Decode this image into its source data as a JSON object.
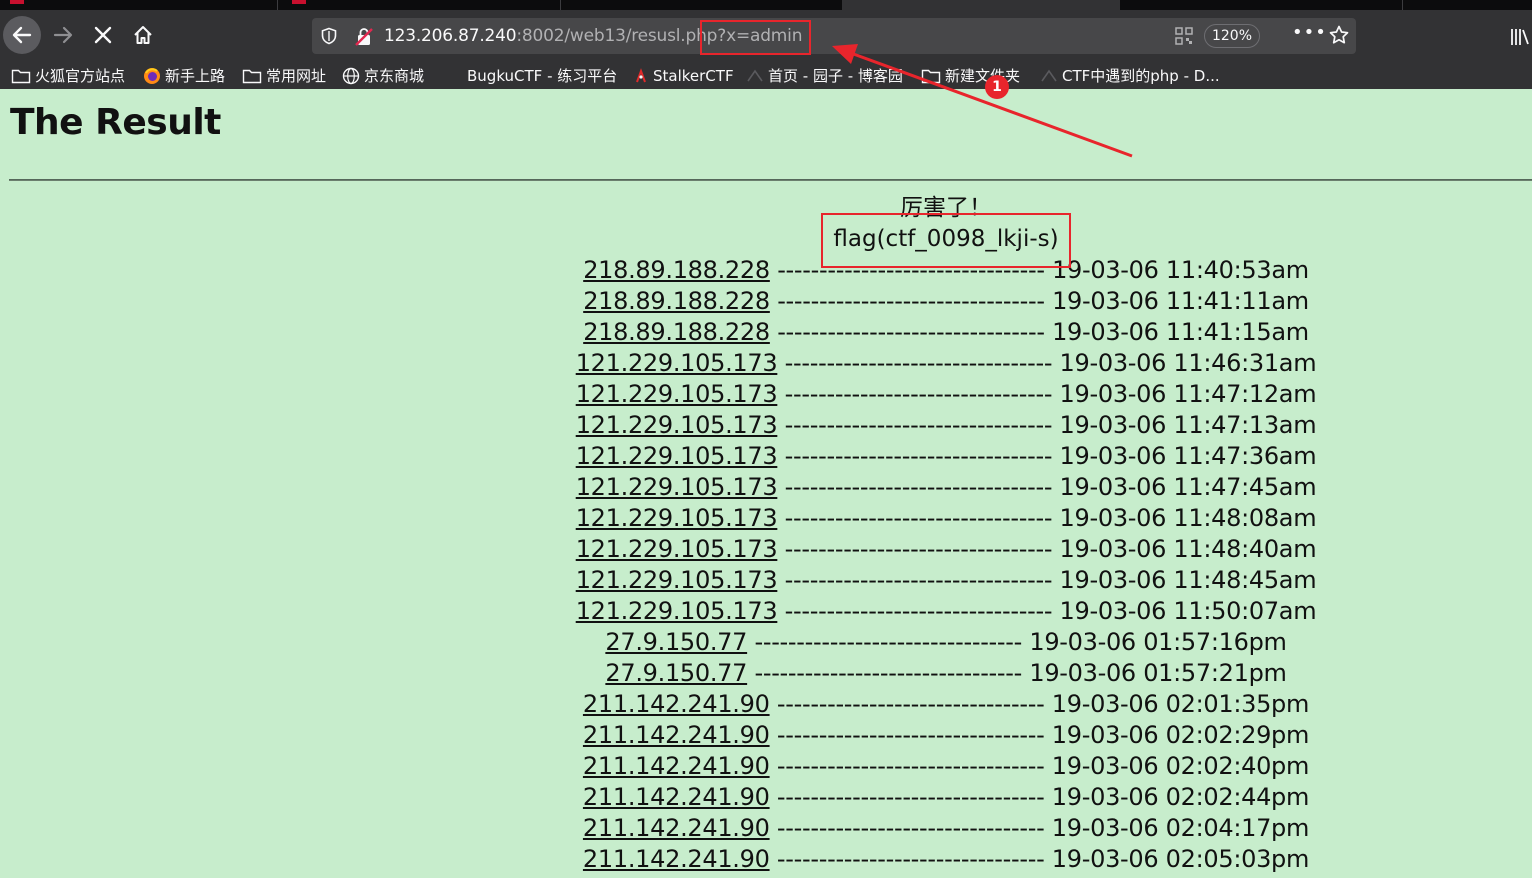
{
  "browser": {
    "url_host": "123.206.87.240",
    "url_rest": ":8002/web13/resusl.php?x=admin",
    "zoom": "120%",
    "more": "•••"
  },
  "bookmarks": [
    {
      "label": "火狐官方站点",
      "icon": "folder-icon"
    },
    {
      "label": "新手上路",
      "icon": "firefox-icon"
    },
    {
      "label": "常用网址",
      "icon": "folder-icon"
    },
    {
      "label": "京东商城",
      "icon": "globe-icon"
    },
    {
      "label": "BugkuCTF - 练习平台",
      "icon": "none"
    },
    {
      "label": "StalkerCTF",
      "icon": "ctf-icon"
    },
    {
      "label": "首页 - 园子 - 博客园",
      "icon": "blog-icon"
    },
    {
      "label": "新建文件夹",
      "icon": "folder-icon"
    },
    {
      "label": "CTF中遇到的php - D...",
      "icon": "ctf-icon"
    }
  ],
  "page": {
    "title": "The Result",
    "message": "厉害了！",
    "flag": "flag(ctf_0098_lkji-s)",
    "separator": "--------------------------------",
    "rows": [
      {
        "ip": "218.89.188.228",
        "time": "19-03-06 11:40:53am"
      },
      {
        "ip": "218.89.188.228",
        "time": "19-03-06 11:41:11am"
      },
      {
        "ip": "218.89.188.228",
        "time": "19-03-06 11:41:15am"
      },
      {
        "ip": "121.229.105.173",
        "time": "19-03-06 11:46:31am"
      },
      {
        "ip": "121.229.105.173",
        "time": "19-03-06 11:47:12am"
      },
      {
        "ip": "121.229.105.173",
        "time": "19-03-06 11:47:13am"
      },
      {
        "ip": "121.229.105.173",
        "time": "19-03-06 11:47:36am"
      },
      {
        "ip": "121.229.105.173",
        "time": "19-03-06 11:47:45am"
      },
      {
        "ip": "121.229.105.173",
        "time": "19-03-06 11:48:08am"
      },
      {
        "ip": "121.229.105.173",
        "time": "19-03-06 11:48:40am"
      },
      {
        "ip": "121.229.105.173",
        "time": "19-03-06 11:48:45am"
      },
      {
        "ip": "121.229.105.173",
        "time": "19-03-06 11:50:07am"
      },
      {
        "ip": "27.9.150.77",
        "time": "19-03-06 01:57:16pm"
      },
      {
        "ip": "27.9.150.77",
        "time": "19-03-06 01:57:21pm"
      },
      {
        "ip": "211.142.241.90",
        "time": "19-03-06 02:01:35pm"
      },
      {
        "ip": "211.142.241.90",
        "time": "19-03-06 02:02:29pm"
      },
      {
        "ip": "211.142.241.90",
        "time": "19-03-06 02:02:40pm"
      },
      {
        "ip": "211.142.241.90",
        "time": "19-03-06 02:02:44pm"
      },
      {
        "ip": "211.142.241.90",
        "time": "19-03-06 02:04:17pm"
      },
      {
        "ip": "211.142.241.90",
        "time": "19-03-06 02:05:03pm"
      }
    ]
  },
  "annotation": {
    "badge": "1",
    "color": "#e8252c"
  }
}
